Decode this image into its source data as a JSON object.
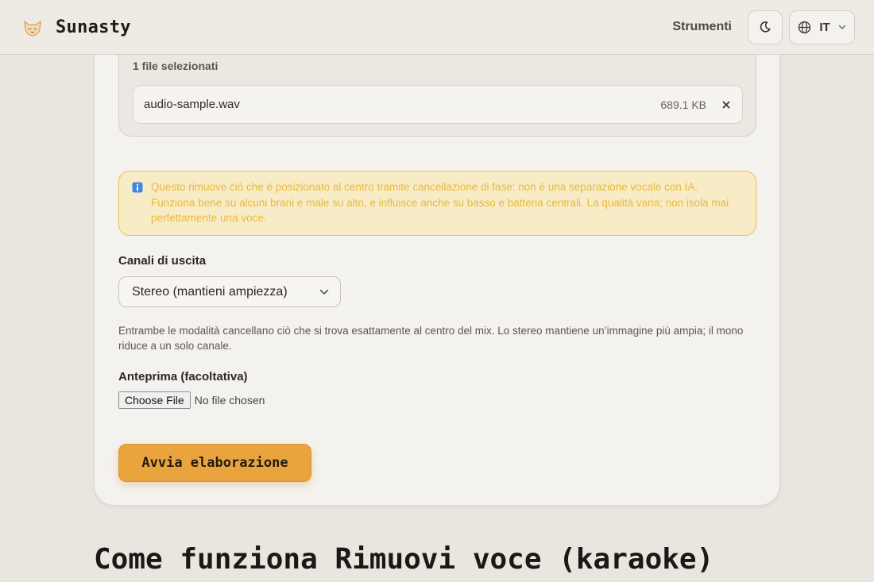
{
  "header": {
    "brand": "Sunasty",
    "nav_tools": "Strumenti",
    "language": "IT",
    "logo_icon": "fox-icon",
    "theme_icon": "moon-icon",
    "language_icon": "globe-icon"
  },
  "upload": {
    "selected_count": "1 file selezionati",
    "files": [
      {
        "name": "audio-sample.wav",
        "size": "689.1 KB"
      }
    ]
  },
  "warning": {
    "icon": "info-icon",
    "text": "Questo rimuove ciò che è posizionato al centro tramite cancellazione di fase: non è una separazione vocale con IA. Funziona bene su alcuni brani e male su altri, e influisce anche su basso e batteria centrali. La qualità varia; non isola mai perfettamente una voce."
  },
  "output": {
    "label": "Canali di uscita",
    "selected": "Stereo (mantieni ampiezza)",
    "help": "Entrambe le modalità cancellano ciò che si trova esattamente al centro del mix. Lo stereo mantiene un’immagine più ampia; il mono riduce a un solo canale."
  },
  "preview": {
    "label": "Anteprima (facoltativa)",
    "choose_label": "Choose File",
    "no_file": "No file chosen"
  },
  "actions": {
    "start": "Avvia elaborazione"
  },
  "section": {
    "title": "Come funziona Rimuovi voce (karaoke)"
  },
  "colors": {
    "accent": "#eaa43d",
    "warning_bg": "#f8ecc7",
    "warning_border": "#eebf3f",
    "page_bg": "#e9e6e0"
  }
}
